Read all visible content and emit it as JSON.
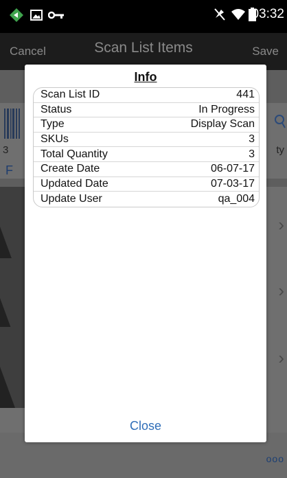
{
  "status_bar": {
    "time": "03:32",
    "icons": [
      "location-app-icon",
      "image-notification-icon",
      "key-icon",
      "mute-icon",
      "wifi-icon",
      "battery-icon"
    ]
  },
  "header": {
    "cancel_label": "Cancel",
    "title": "Scan List Items",
    "save_label": "Save"
  },
  "background": {
    "count_left": "3",
    "label_right": "ty",
    "letter": "F",
    "more": "ooo"
  },
  "dialog": {
    "title": "Info",
    "rows": [
      {
        "label": "Scan List ID",
        "value": "441"
      },
      {
        "label": "Status",
        "value": "In Progress"
      },
      {
        "label": "Type",
        "value": "Display Scan"
      },
      {
        "label": "SKUs",
        "value": "3"
      },
      {
        "label": "Total Quantity",
        "value": "3"
      },
      {
        "label": "Create Date",
        "value": "06-07-17"
      },
      {
        "label": "Updated Date",
        "value": "07-03-17"
      },
      {
        "label": "Update User",
        "value": "qa_004"
      }
    ],
    "close_label": "Close"
  },
  "colors": {
    "accent": "#2e6db8",
    "statusbar": "#000000",
    "overlay": "#6f6f6f"
  }
}
